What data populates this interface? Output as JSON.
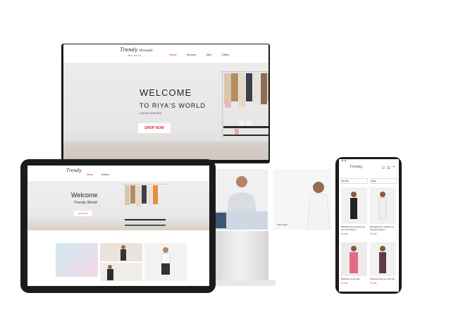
{
  "desktop": {
    "logo_top": "Trendy",
    "logo_bottom": "threads",
    "logo_sub": "BY RIYA",
    "nav": [
      "Home",
      "Women",
      "Men",
      "Offers"
    ],
    "active_nav": "Home",
    "hero_title": "WELCOME",
    "hero_subtitle": "TO RIYA'S WORLD",
    "hero_collection": "COLLECTION 2025",
    "cta": "SHOP NOW",
    "card_caption": "Bed Seats"
  },
  "tablet": {
    "nav": [
      "Home",
      "Women"
    ],
    "hero_title": "Welcome",
    "hero_subtitle": "Trendy World",
    "cta": "Shop Now"
  },
  "phone": {
    "status_time": "08:18",
    "filter_label": "Sort By",
    "sort_label": "Filter",
    "products": [
      {
        "title": "Midnight Onyx Sequin Co-Ord Set Women",
        "price": "₹1,999"
      },
      {
        "title": "Midnight Onyx Sequin Co-Ord Set Women",
        "price": "₹1,999"
      },
      {
        "title": "Butterfly Co-ord Set",
        "price": "₹1,499"
      },
      {
        "title": "Printed Cotton Co-Ord Set",
        "price": "₹1,399"
      }
    ]
  },
  "colors": {
    "accent": "#d9263a",
    "bezel": "#1b1b1b",
    "hero_bg": "#ececec"
  }
}
